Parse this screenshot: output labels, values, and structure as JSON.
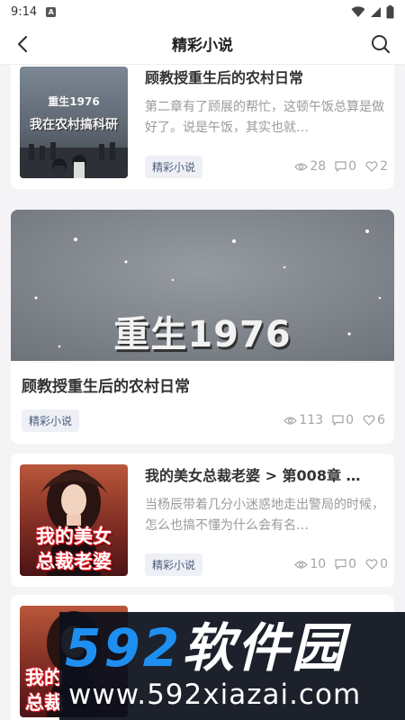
{
  "status_bar": {
    "time": "9:14",
    "notification_letter": "A"
  },
  "nav": {
    "title": "精彩小说"
  },
  "cards": [
    {
      "title": "顾教授重生后的农村日常",
      "excerpt": "第二章有了顾展的帮忙，这顿午饭总算是做好了。说是午饭，其实也就…",
      "tag": "精彩小说",
      "views": "28",
      "comments": "0",
      "likes": "2",
      "cover_line1": "重生1976",
      "cover_line2": "我在农村搞科研"
    },
    {
      "title": "顾教授重生后的农村日常",
      "tag": "精彩小说",
      "views": "113",
      "comments": "0",
      "likes": "6",
      "banner_text": "重生1976"
    },
    {
      "title": "我的美女总裁老婆 > 第008章 …",
      "excerpt": "当杨辰带着几分小迷惑地走出警局的时候，怎么也搞不懂为什么会有名…",
      "tag": "精彩小说",
      "views": "10",
      "comments": "0",
      "likes": "0",
      "cover_line1": "我的美女",
      "cover_line2": "总裁老婆"
    },
    {
      "cover_line1": "我的",
      "cover_line2": "总裁"
    }
  ],
  "watermark": {
    "brand_digits": "592",
    "brand_name": "软件园",
    "url": "www.592xiazai.com"
  },
  "colors": {
    "tag_bg": "#eef0f5",
    "tag_text": "#4a5a7a",
    "meta_gray": "#a6a6a6",
    "watermark_blue": "#1e8ff0"
  }
}
